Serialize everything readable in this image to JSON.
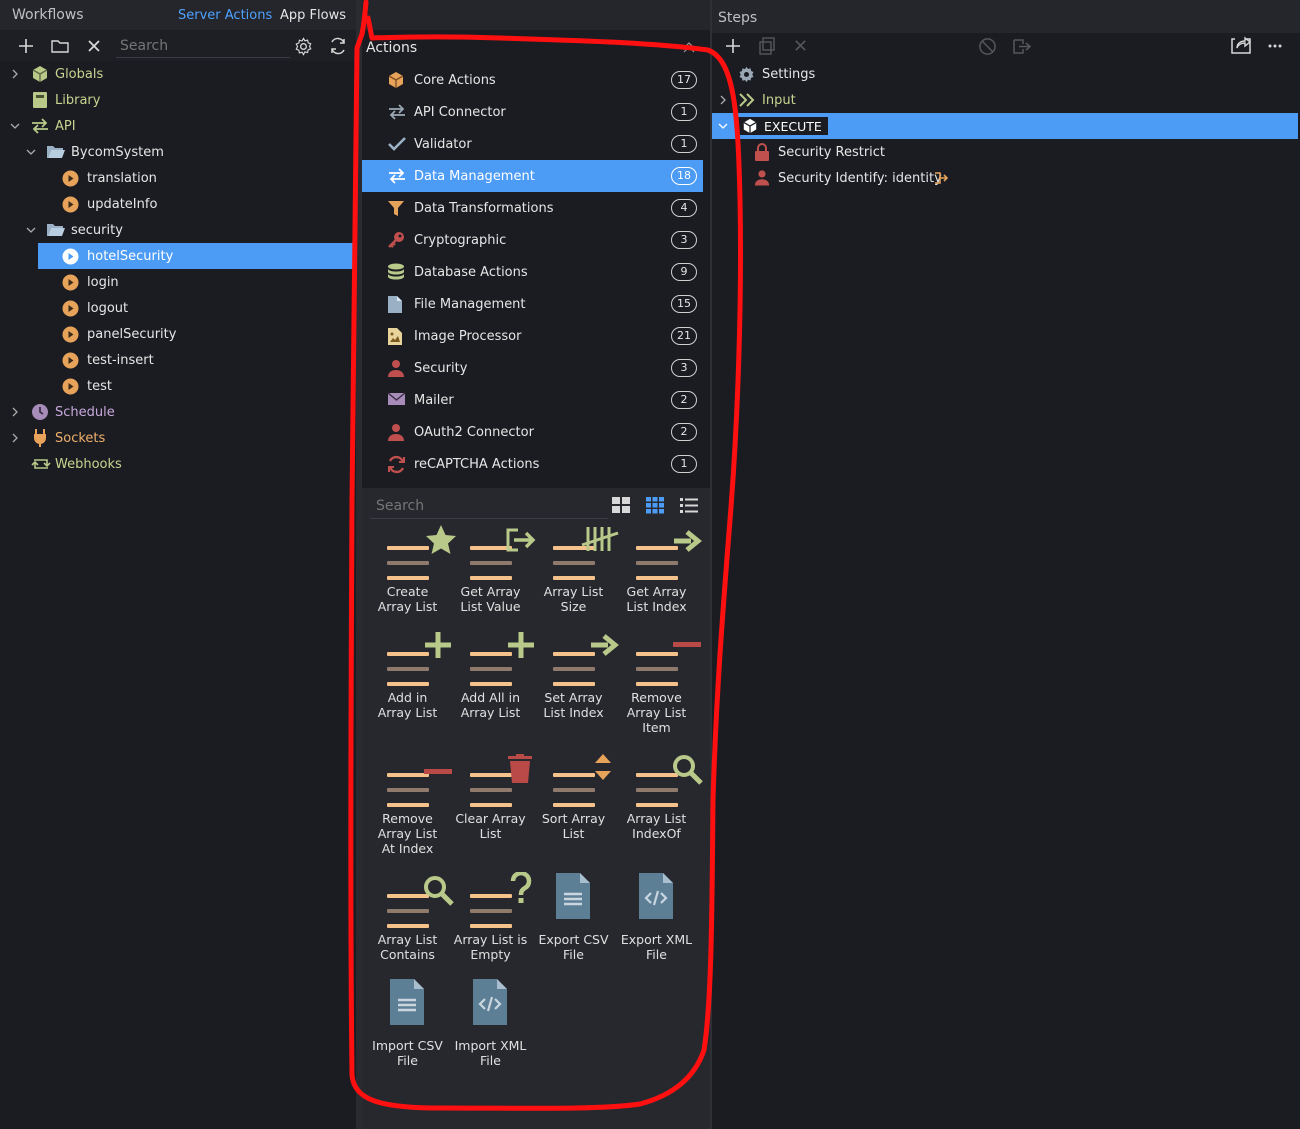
{
  "workflows": {
    "title": "Workflows",
    "tabs": [
      {
        "label": "Server Actions",
        "active": true
      },
      {
        "label": "App Flows",
        "active": false
      }
    ],
    "search_placeholder": "Search",
    "tree": [
      {
        "label": "Globals"
      },
      {
        "label": "Library"
      },
      {
        "label": "API"
      },
      {
        "label": "BycomSystem"
      },
      {
        "label": "translation"
      },
      {
        "label": "updateInfo"
      },
      {
        "label": "security"
      },
      {
        "label": "hotelSecurity"
      },
      {
        "label": "login"
      },
      {
        "label": "logout"
      },
      {
        "label": "panelSecurity"
      },
      {
        "label": "test-insert"
      },
      {
        "label": "test"
      },
      {
        "label": "Schedule"
      },
      {
        "label": "Sockets"
      },
      {
        "label": "Webhooks"
      }
    ]
  },
  "actions": {
    "title": "Actions",
    "categories": [
      {
        "label": "Core Actions",
        "count": "17"
      },
      {
        "label": "API Connector",
        "count": "1"
      },
      {
        "label": "Validator",
        "count": "1"
      },
      {
        "label": "Data Management",
        "count": "18"
      },
      {
        "label": "Data Transformations",
        "count": "4"
      },
      {
        "label": "Cryptographic",
        "count": "3"
      },
      {
        "label": "Database Actions",
        "count": "9"
      },
      {
        "label": "File Management",
        "count": "15"
      },
      {
        "label": "Image Processor",
        "count": "21"
      },
      {
        "label": "Security",
        "count": "3"
      },
      {
        "label": "Mailer",
        "count": "2"
      },
      {
        "label": "OAuth2 Connector",
        "count": "2"
      },
      {
        "label": "reCAPTCHA Actions",
        "count": "1"
      }
    ],
    "search_placeholder": "Search",
    "tiles": [
      {
        "label": "Create\nArray List"
      },
      {
        "label": "Get Array\nList Value"
      },
      {
        "label": "Array List\nSize"
      },
      {
        "label": "Get Array\nList Index"
      },
      {
        "label": "Add in\nArray List"
      },
      {
        "label": "Add All in\nArray List"
      },
      {
        "label": "Set Array\nList Index"
      },
      {
        "label": "Remove\nArray List\nItem"
      },
      {
        "label": "Remove\nArray List\nAt Index"
      },
      {
        "label": "Clear Array\nList"
      },
      {
        "label": "Sort Array\nList"
      },
      {
        "label": "Array List\nIndexOf"
      },
      {
        "label": "Array List\nContains"
      },
      {
        "label": "Array List is\nEmpty"
      },
      {
        "label": "Export CSV\nFile"
      },
      {
        "label": "Export XML\nFile"
      },
      {
        "label": "Import CSV\nFile"
      },
      {
        "label": "Import XML\nFile"
      }
    ]
  },
  "steps": {
    "title": "Steps",
    "items": [
      {
        "label": "Settings"
      },
      {
        "label": "Input"
      },
      {
        "label": "EXECUTE"
      },
      {
        "label": "Security Restrict"
      },
      {
        "label": "Security Identify: identity"
      }
    ]
  },
  "colors": {
    "selection": "#4c9bf5",
    "folder_green": "#b9c98a",
    "action_orange": "#e8a35a",
    "annotation_red": "#ff1010"
  }
}
